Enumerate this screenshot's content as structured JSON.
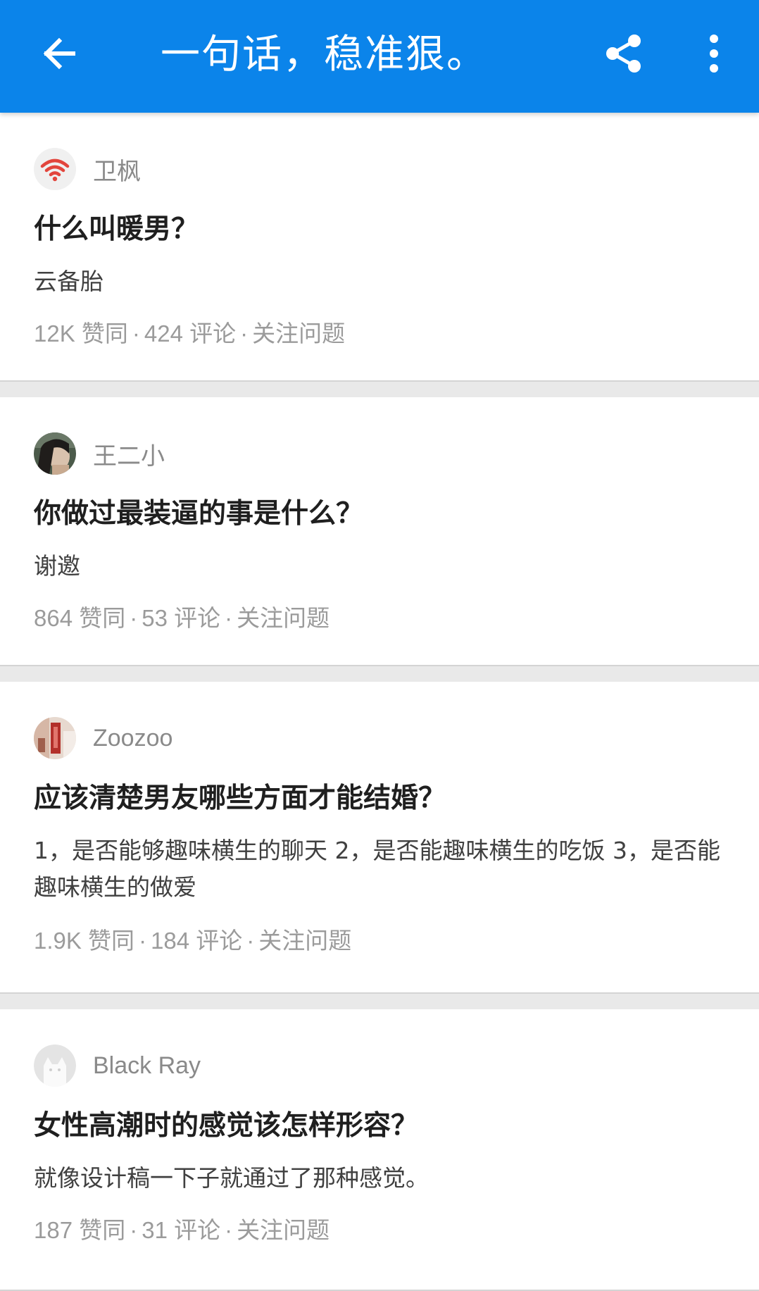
{
  "app_bar": {
    "title": "一句话，稳准狠。",
    "back_icon": "arrow-left-icon",
    "share_icon": "share-icon",
    "more_icon": "more-vertical-icon",
    "color": "#0b84ea"
  },
  "cards": [
    {
      "author": "卫枫",
      "avatar": "wifi-logo",
      "question": "什么叫暖男？",
      "excerpt": "云备胎",
      "votes": "12K 赞同",
      "comments": "424 评论",
      "follow": "关注问题"
    },
    {
      "author": "王二小",
      "avatar": "photo-portrait",
      "question": "你做过最装逼的事是什么？",
      "excerpt": "谢邀",
      "votes": "864 赞同",
      "comments": "53 评论",
      "follow": "关注问题"
    },
    {
      "author": "Zoozoo",
      "avatar": "photo-room",
      "question": "应该清楚男友哪些方面才能结婚？",
      "excerpt": "1，是否能够趣味横生的聊天 2，是否能趣味横生的吃饭 3，是否能趣味横生的做爱",
      "votes": "1.9K 赞同",
      "comments": "184 评论",
      "follow": "关注问题"
    },
    {
      "author": "Black Ray",
      "avatar": "default-cat-avatar",
      "question": "女性高潮时的感觉该怎样形容？",
      "excerpt": "就像设计稿一下子就通过了那种感觉。",
      "votes": "187 赞同",
      "comments": "31 评论",
      "follow": "关注问题"
    }
  ],
  "separator": "·"
}
